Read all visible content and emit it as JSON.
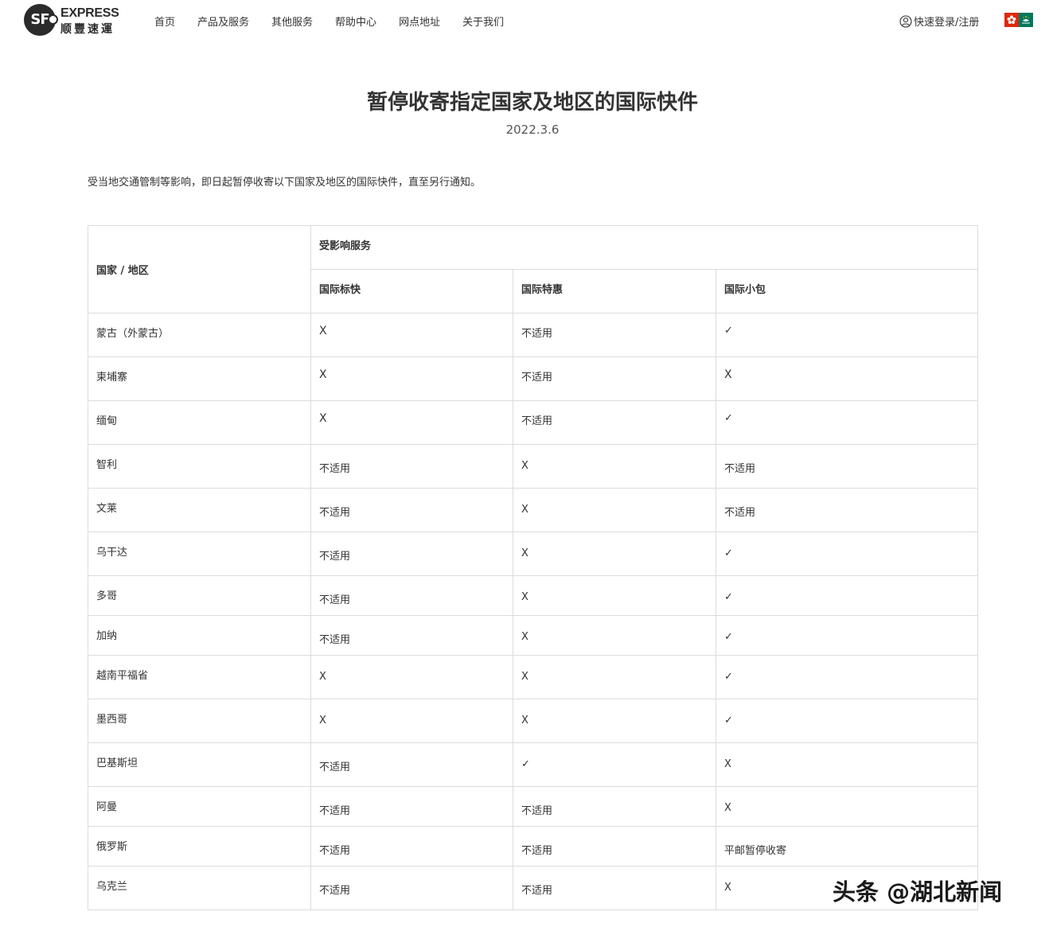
{
  "header": {
    "logo_en": "EXPRESS",
    "logo_zh": "顺豐速運",
    "logo_mark": "SF",
    "nav": [
      "首页",
      "产品及服务",
      "其他服务",
      "帮助中心",
      "网点地址",
      "关于我们"
    ],
    "login_label": "快速登录/注册",
    "user_icon": "user-circle-icon",
    "flags": [
      "hong-kong-flag-icon",
      "macau-flag-icon"
    ]
  },
  "article": {
    "title": "暂停收寄指定国家及地区的国际快件",
    "date": "2022.3.6",
    "intro": "受当地交通管制等影响，即日起暂停收寄以下国家及地区的国际快件，直至另行通知。"
  },
  "table": {
    "country_header": "国家 / 地区",
    "service_header": "受影响服务",
    "columns": [
      "国际标快",
      "国际特惠",
      "国际小包"
    ],
    "rows": [
      {
        "country": "蒙古（外蒙古）",
        "cells": [
          "X",
          "不适用",
          "✓"
        ]
      },
      {
        "country": "柬埔寨",
        "cells": [
          "X",
          "不适用",
          "X"
        ]
      },
      {
        "country": "缅甸",
        "cells": [
          "X",
          "不适用",
          "✓"
        ]
      },
      {
        "country": "智利",
        "cells": [
          "不适用",
          "X",
          "不适用"
        ]
      },
      {
        "country": "文莱",
        "cells": [
          "不适用",
          "X",
          "不适用"
        ]
      },
      {
        "country": "乌干达",
        "cells": [
          "不适用",
          "X",
          "✓"
        ]
      },
      {
        "country": "多哥",
        "cells": [
          "不适用",
          "X",
          "✓"
        ]
      },
      {
        "country": "加纳",
        "cells": [
          "不适用",
          "X",
          "✓"
        ]
      },
      {
        "country": "越南平福省",
        "cells": [
          "X",
          "X",
          "✓"
        ]
      },
      {
        "country": "墨西哥",
        "cells": [
          "X",
          "X",
          "✓"
        ]
      },
      {
        "country": "巴基斯坦",
        "cells": [
          "不适用",
          "✓",
          "X"
        ]
      },
      {
        "country": "阿曼",
        "cells": [
          "不适用",
          "不适用",
          "X"
        ]
      },
      {
        "country": "俄罗斯",
        "cells": [
          "不适用",
          "不适用",
          "平邮暂停收寄"
        ]
      },
      {
        "country": "乌克兰",
        "cells": [
          "不适用",
          "不适用",
          "X"
        ]
      }
    ]
  },
  "watermark": "头条 @湖北新闻"
}
